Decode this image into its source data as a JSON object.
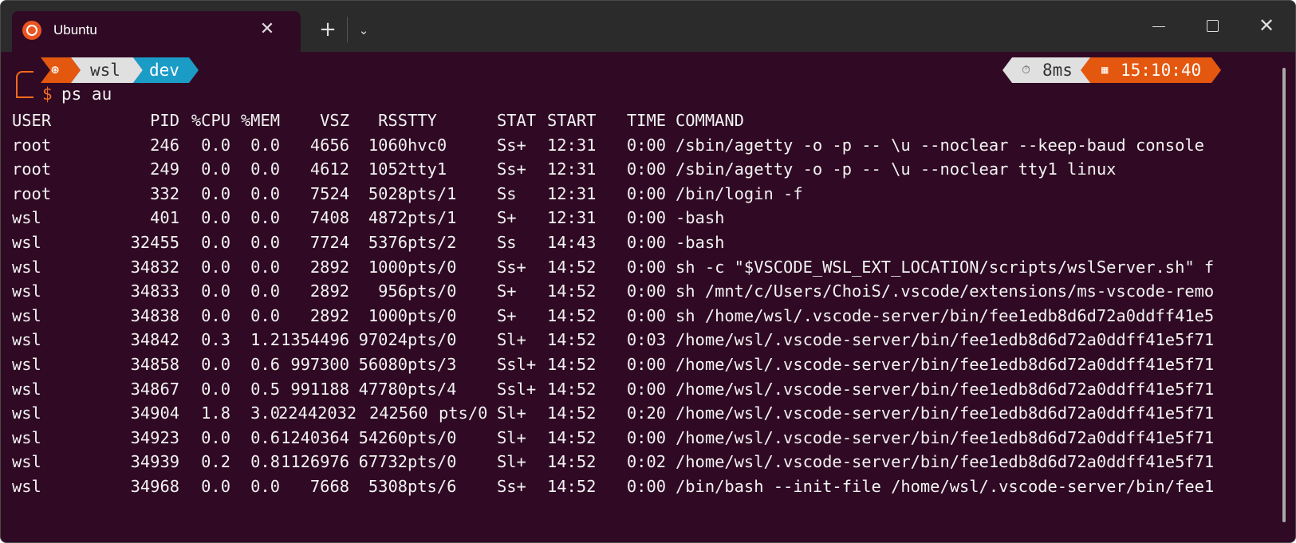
{
  "window": {
    "tab_title": "Ubuntu",
    "tab_close_symbol": "✕",
    "new_tab_symbol": "+",
    "dropdown_symbol": "⌄",
    "close_symbol": "✕",
    "accent_color": "#e95420",
    "background_color": "#300a24"
  },
  "prompt": {
    "os_icon": "ubuntu-icon",
    "user": "wsl",
    "dir": "dev",
    "duration_icon": "stopwatch-icon",
    "duration": "8ms",
    "clock_icon": "calendar-icon",
    "time": "15:10:40",
    "symbol": "$",
    "command": "ps au",
    "colors": {
      "os": "#e4570e",
      "user": "#e0e0e0",
      "dir": "#1a9cc7",
      "duration": "#e0e0e0",
      "time": "#e4570e"
    }
  },
  "ps": {
    "headers": {
      "user": "USER",
      "pid": "PID",
      "cpu": "%CPU",
      "mem": "%MEM",
      "vsz": "VSZ",
      "rss": "RSS",
      "tty": "TTY",
      "stat": "STAT",
      "start": "START",
      "time": "TIME",
      "command": "COMMAND"
    },
    "rows": [
      {
        "user": "root",
        "pid": "246",
        "cpu": "0.0",
        "mem": "0.0",
        "vsz": "4656",
        "rss": "1060",
        "tty": "hvc0",
        "stat": "Ss+",
        "start": "12:31",
        "time": "0:00",
        "command": "/sbin/agetty -o -p -- \\u --noclear --keep-baud console"
      },
      {
        "user": "root",
        "pid": "249",
        "cpu": "0.0",
        "mem": "0.0",
        "vsz": "4612",
        "rss": "1052",
        "tty": "tty1",
        "stat": "Ss+",
        "start": "12:31",
        "time": "0:00",
        "command": "/sbin/agetty -o -p -- \\u --noclear tty1 linux"
      },
      {
        "user": "root",
        "pid": "332",
        "cpu": "0.0",
        "mem": "0.0",
        "vsz": "7524",
        "rss": "5028",
        "tty": "pts/1",
        "stat": "Ss",
        "start": "12:31",
        "time": "0:00",
        "command": "/bin/login -f"
      },
      {
        "user": "wsl",
        "pid": "401",
        "cpu": "0.0",
        "mem": "0.0",
        "vsz": "7408",
        "rss": "4872",
        "tty": "pts/1",
        "stat": "S+",
        "start": "12:31",
        "time": "0:00",
        "command": "-bash"
      },
      {
        "user": "wsl",
        "pid": "32455",
        "cpu": "0.0",
        "mem": "0.0",
        "vsz": "7724",
        "rss": "5376",
        "tty": "pts/2",
        "stat": "Ss",
        "start": "14:43",
        "time": "0:00",
        "command": "-bash"
      },
      {
        "user": "wsl",
        "pid": "34832",
        "cpu": "0.0",
        "mem": "0.0",
        "vsz": "2892",
        "rss": "1000",
        "tty": "pts/0",
        "stat": "Ss+",
        "start": "14:52",
        "time": "0:00",
        "command": "sh -c \"$VSCODE_WSL_EXT_LOCATION/scripts/wslServer.sh\" f"
      },
      {
        "user": "wsl",
        "pid": "34833",
        "cpu": "0.0",
        "mem": "0.0",
        "vsz": "2892",
        "rss": "956",
        "tty": "pts/0",
        "stat": "S+",
        "start": "14:52",
        "time": "0:00",
        "command": "sh /mnt/c/Users/ChoiS/.vscode/extensions/ms-vscode-remo"
      },
      {
        "user": "wsl",
        "pid": "34838",
        "cpu": "0.0",
        "mem": "0.0",
        "vsz": "2892",
        "rss": "1000",
        "tty": "pts/0",
        "stat": "S+",
        "start": "14:52",
        "time": "0:00",
        "command": "sh /home/wsl/.vscode-server/bin/fee1edb8d6d72a0ddff41e5"
      },
      {
        "user": "wsl",
        "pid": "34842",
        "cpu": "0.3",
        "mem": "1.2",
        "vsz": "1354496",
        "rss": "97024",
        "tty": "pts/0",
        "stat": "Sl+",
        "start": "14:52",
        "time": "0:03",
        "command": "/home/wsl/.vscode-server/bin/fee1edb8d6d72a0ddff41e5f71"
      },
      {
        "user": "wsl",
        "pid": "34858",
        "cpu": "0.0",
        "mem": "0.6",
        "vsz": "997300",
        "rss": "56080",
        "tty": "pts/3",
        "stat": "Ssl+",
        "start": "14:52",
        "time": "0:00",
        "command": "/home/wsl/.vscode-server/bin/fee1edb8d6d72a0ddff41e5f71"
      },
      {
        "user": "wsl",
        "pid": "34867",
        "cpu": "0.0",
        "mem": "0.5",
        "vsz": "991188",
        "rss": "47780",
        "tty": "pts/4",
        "stat": "Ssl+",
        "start": "14:52",
        "time": "0:00",
        "command": "/home/wsl/.vscode-server/bin/fee1edb8d6d72a0ddff41e5f71"
      },
      {
        "user": "wsl",
        "pid": "34904",
        "cpu": "1.8",
        "mem": "3.0",
        "vsz": "22442032",
        "rss": "242560",
        "tty": "pts/0",
        "stat": "Sl+",
        "start": "14:52",
        "time": "0:20",
        "command": "/home/wsl/.vscode-server/bin/fee1edb8d6d72a0ddff41e5f71"
      },
      {
        "user": "wsl",
        "pid": "34923",
        "cpu": "0.0",
        "mem": "0.6",
        "vsz": "1240364",
        "rss": "54260",
        "tty": "pts/0",
        "stat": "Sl+",
        "start": "14:52",
        "time": "0:00",
        "command": "/home/wsl/.vscode-server/bin/fee1edb8d6d72a0ddff41e5f71"
      },
      {
        "user": "wsl",
        "pid": "34939",
        "cpu": "0.2",
        "mem": "0.8",
        "vsz": "1126976",
        "rss": "67732",
        "tty": "pts/0",
        "stat": "Sl+",
        "start": "14:52",
        "time": "0:02",
        "command": "/home/wsl/.vscode-server/bin/fee1edb8d6d72a0ddff41e5f71"
      },
      {
        "user": "wsl",
        "pid": "34968",
        "cpu": "0.0",
        "mem": "0.0",
        "vsz": "7668",
        "rss": "5308",
        "tty": "pts/6",
        "stat": "Ss+",
        "start": "14:52",
        "time": "0:00",
        "command": "/bin/bash --init-file /home/wsl/.vscode-server/bin/fee1"
      }
    ]
  }
}
